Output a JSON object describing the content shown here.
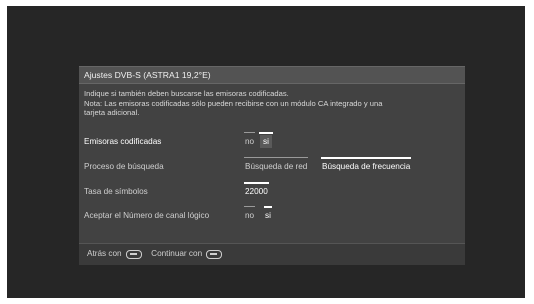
{
  "dialog": {
    "title": "Ajustes DVB-S (ASTRA1 19,2°E)",
    "info_lines": [
      "Indique si también deben buscarse las emisoras codificadas.",
      "Nota: Las emisoras codificadas sólo pueden recibirse con un módulo CA integrado y una",
      "tarjeta adicional."
    ]
  },
  "rows": {
    "encrypted": {
      "label": "Emisoras codificadas",
      "options": [
        "no",
        "si"
      ],
      "selected": "si"
    },
    "search": {
      "label": "Proceso de búsqueda",
      "options": [
        "Búsqueda de red",
        "Búsqueda de frecuencia"
      ],
      "selected": "Búsqueda de frecuencia"
    },
    "symbol_rate": {
      "label": "Tasa de símbolos",
      "value": "22000"
    },
    "lcn": {
      "label": "Aceptar el Número de canal lógico",
      "options": [
        "no",
        "si"
      ],
      "selected": "si"
    }
  },
  "footer": {
    "back_label": "Atrás con",
    "back_icon": "rewind-button-icon",
    "continue_label": "Continuar con",
    "continue_icon": "fast-forward-button-icon"
  }
}
